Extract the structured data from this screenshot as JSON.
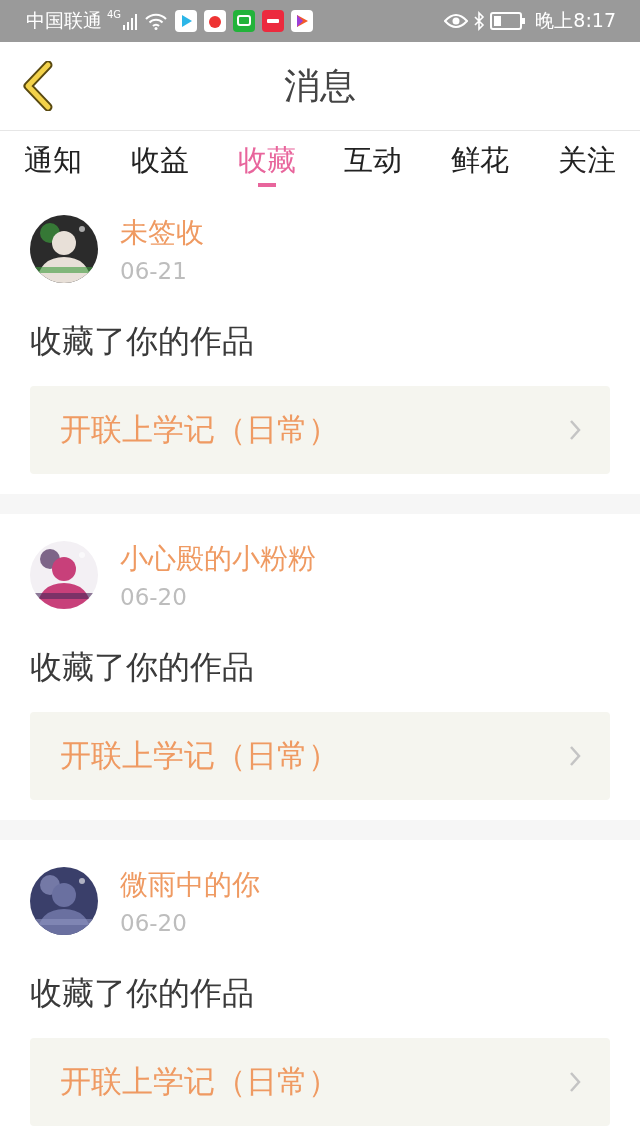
{
  "status_bar": {
    "carrier": "中国联通",
    "network": "4G",
    "time": "晚上8:17"
  },
  "header": {
    "title": "消息"
  },
  "tabs": [
    {
      "label": "通知",
      "selected": false
    },
    {
      "label": "收益",
      "selected": false
    },
    {
      "label": "收藏",
      "selected": true
    },
    {
      "label": "互动",
      "selected": false
    },
    {
      "label": "鲜花",
      "selected": false
    },
    {
      "label": "关注",
      "selected": false
    }
  ],
  "messages": [
    {
      "user": "未签收",
      "date": "06-21",
      "text": "收藏了你的作品",
      "work": "开联上学记（日常）"
    },
    {
      "user": "小心殿的小粉粉",
      "date": "06-20",
      "text": "收藏了你的作品",
      "work": "开联上学记（日常）"
    },
    {
      "user": "微雨中的你",
      "date": "06-20",
      "text": "收藏了你的作品",
      "work": "开联上学记（日常）"
    }
  ]
}
